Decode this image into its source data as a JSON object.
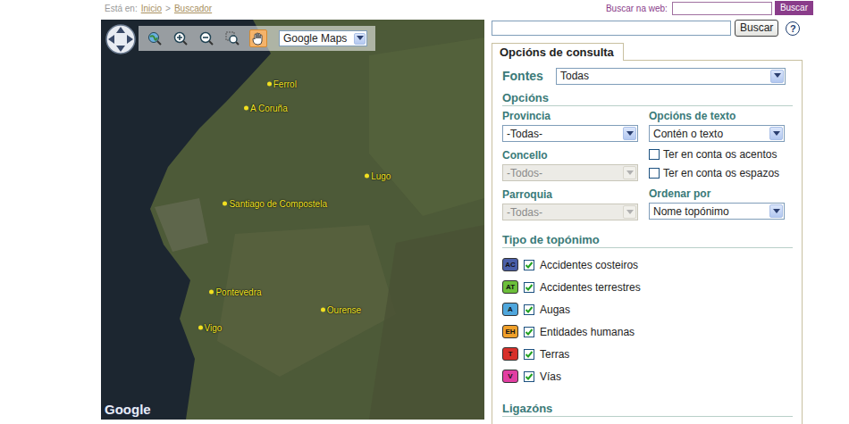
{
  "breadcrumb": {
    "label": "Está en:",
    "items": [
      "Inicio",
      "Buscador"
    ],
    "separator": ">"
  },
  "web_search": {
    "label": "Buscar na web:",
    "value": "",
    "button": "Buscar"
  },
  "map": {
    "type_select": "Google Maps",
    "logo": "Google",
    "tools": [
      {
        "kind": "world",
        "selected": false
      },
      {
        "kind": "zoom-in",
        "selected": false
      },
      {
        "kind": "zoom-out",
        "selected": false
      },
      {
        "kind": "zoom-box",
        "selected": false
      },
      {
        "kind": "hand",
        "selected": true
      }
    ],
    "cities": [
      {
        "name": "Ferrol"
      },
      {
        "name": "A Coruña"
      },
      {
        "name": "Lugo"
      },
      {
        "name": "Santiago de Compostela"
      },
      {
        "name": "Pontevedra"
      },
      {
        "name": "Ourense"
      },
      {
        "name": "Vigo"
      }
    ]
  },
  "search": {
    "value": "",
    "button": "Buscar",
    "help": "?"
  },
  "tabs": [
    {
      "label": "Opcións de consulta",
      "selected": true
    }
  ],
  "sources": {
    "label": "Fontes",
    "value": "Todas"
  },
  "options": {
    "heading": "Opcións",
    "left": [
      {
        "label": "Provincia",
        "value": "-Todas-",
        "disabled": false
      },
      {
        "label": "Concello",
        "value": "-Todos-",
        "disabled": true
      },
      {
        "label": "Parroquia",
        "value": "-Todas-",
        "disabled": true
      }
    ],
    "text_options": {
      "label": "Opcións de texto",
      "value": "Contén o texto"
    },
    "checkboxes": [
      {
        "label": "Ter en conta os acentos",
        "checked": false
      },
      {
        "label": "Ter en conta os espazos",
        "checked": false
      }
    ],
    "order": {
      "label": "Ordenar por",
      "value": "Nome topónimo"
    }
  },
  "types": {
    "heading": "Tipo de topónimo",
    "items": [
      {
        "badge": "AC",
        "label": "Accidentes costeiros",
        "checked": true,
        "color": "#4a5fa8"
      },
      {
        "badge": "AT",
        "label": "Accidentes terrestres",
        "checked": true,
        "color": "#6cbf3a"
      },
      {
        "badge": "A",
        "label": "Augas",
        "checked": true,
        "color": "#4fa6dc"
      },
      {
        "badge": "EH",
        "label": "Entidades humanas",
        "checked": true,
        "color": "#f0a02a"
      },
      {
        "badge": "T",
        "label": "Terras",
        "checked": true,
        "color": "#d8302a"
      },
      {
        "badge": "V",
        "label": "Vías",
        "checked": true,
        "color": "#e23ea2"
      }
    ]
  },
  "links": {
    "heading": "Ligazóns"
  }
}
